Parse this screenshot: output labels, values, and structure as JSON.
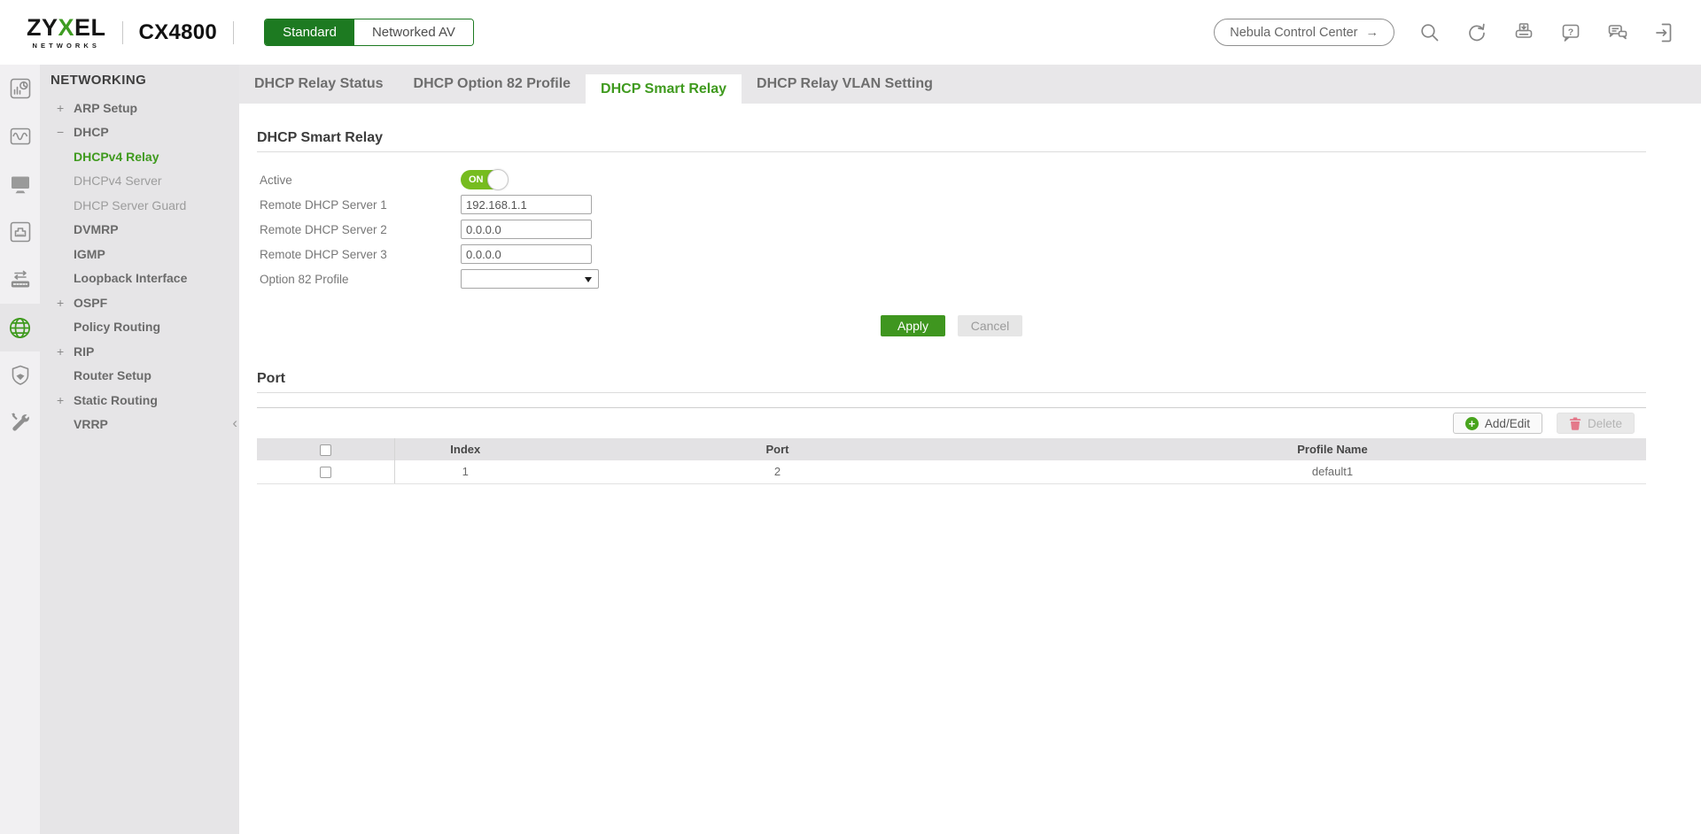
{
  "header": {
    "logo_main": "ZYXEL",
    "logo_sub": "NETWORKS",
    "model": "CX4800",
    "mode": {
      "standard": "Standard",
      "networked_av": "Networked AV"
    },
    "nebula_label": "Nebula Control Center",
    "nebula_arrow": "→",
    "icon_names": [
      "search-icon",
      "refresh-icon",
      "save-config-icon",
      "help-icon",
      "feedback-icon",
      "logout-icon"
    ]
  },
  "sidebar": {
    "rail_icon_names": [
      "dashboard-icon",
      "monitoring-icon",
      "system-icon",
      "port-icon",
      "switching-icon",
      "networking-globe-icon",
      "security-icon",
      "maintenance-icon"
    ],
    "active_rail": "networking-globe-icon",
    "section_title": "NETWORKING",
    "collapse_arrow": "‹",
    "items": [
      {
        "prefix": "+",
        "label": "ARP Setup"
      },
      {
        "prefix": "−",
        "label": "DHCP"
      },
      {
        "prefix": "",
        "label": "DHCPv4 Relay"
      },
      {
        "prefix": "",
        "label": "DHCPv4 Server"
      },
      {
        "prefix": "",
        "label": "DHCP Server Guard"
      },
      {
        "prefix": "",
        "label": "DVMRP"
      },
      {
        "prefix": "",
        "label": "IGMP"
      },
      {
        "prefix": "",
        "label": "Loopback Interface"
      },
      {
        "prefix": "+",
        "label": "OSPF"
      },
      {
        "prefix": "",
        "label": "Policy Routing"
      },
      {
        "prefix": "+",
        "label": "RIP"
      },
      {
        "prefix": "",
        "label": "Router Setup"
      },
      {
        "prefix": "+",
        "label": "Static Routing"
      },
      {
        "prefix": "",
        "label": "VRRP"
      }
    ],
    "active_item": "DHCPv4 Relay"
  },
  "tabs": [
    {
      "label": "DHCP Relay Status"
    },
    {
      "label": "DHCP Option 82 Profile"
    },
    {
      "label": "DHCP Smart Relay"
    },
    {
      "label": "DHCP Relay VLAN Setting"
    }
  ],
  "active_tab": "DHCP Smart Relay",
  "form": {
    "title": "DHCP Smart Relay",
    "active_label": "Active",
    "toggle_state": "ON",
    "fields": [
      {
        "label": "Remote DHCP Server 1",
        "value": "192.168.1.1"
      },
      {
        "label": "Remote DHCP Server 2",
        "value": "0.0.0.0"
      },
      {
        "label": "Remote DHCP Server 3",
        "value": "0.0.0.0"
      }
    ],
    "option82_label": "Option 82 Profile",
    "option82_selected": "",
    "apply_label": "Apply",
    "cancel_label": "Cancel"
  },
  "port_section": {
    "title": "Port",
    "add_edit_label": "Add/Edit",
    "delete_label": "Delete",
    "table": {
      "columns": [
        "Index",
        "Port",
        "Profile Name"
      ],
      "rows": [
        {
          "index": "1",
          "port": "2",
          "profile_name": "default1"
        }
      ]
    }
  },
  "colors": {
    "brand_green": "#3f9a1e",
    "mode_button_green": "#1d7a21",
    "toggle_green": "#76bc1f",
    "apply_green": "#3f961f",
    "delete_pink": "#e4798a",
    "panel_gray": "#e6e5e7",
    "tabstrip_gray": "#e8e7e9",
    "table_header_gray": "#e3e2e4"
  }
}
